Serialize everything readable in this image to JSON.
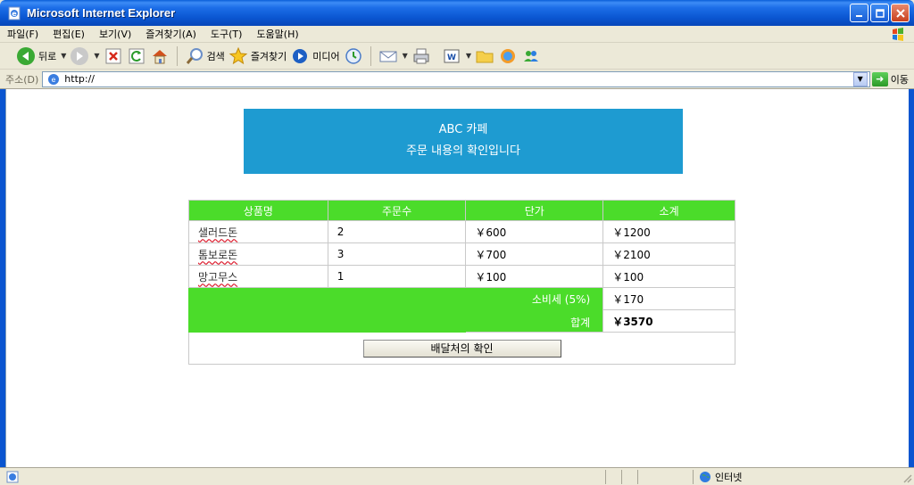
{
  "window": {
    "title": "Microsoft Internet Explorer"
  },
  "menu": {
    "items": [
      "파일(F)",
      "편집(E)",
      "보기(V)",
      "즐겨찾기(A)",
      "도구(T)",
      "도움말(H)"
    ]
  },
  "toolbar": {
    "back": "뒤로",
    "search": "검색",
    "favorites": "즐겨찾기",
    "media": "미디어"
  },
  "address": {
    "label": "주소(D)",
    "url": "http://",
    "go": "이동"
  },
  "banner": {
    "line1": "ABC 카페",
    "line2": "주문 내용의 확인입니다"
  },
  "table": {
    "headers": [
      "상품명",
      "주문수",
      "단가",
      "소계"
    ],
    "rows": [
      {
        "name": "샐러드돈",
        "qty": "2",
        "price": "￥600",
        "subtotal": "￥1200"
      },
      {
        "name": "톰보로돈",
        "qty": "3",
        "price": "￥700",
        "subtotal": "￥2100"
      },
      {
        "name": "망고무스",
        "qty": "1",
        "price": "￥100",
        "subtotal": "￥100"
      }
    ],
    "tax_label": "소비세 (5%)",
    "tax_value": "￥170",
    "total_label": "합계",
    "total_value": "￥3570",
    "confirm_button": "배달처의 확인"
  },
  "status": {
    "zone": "인터넷"
  }
}
